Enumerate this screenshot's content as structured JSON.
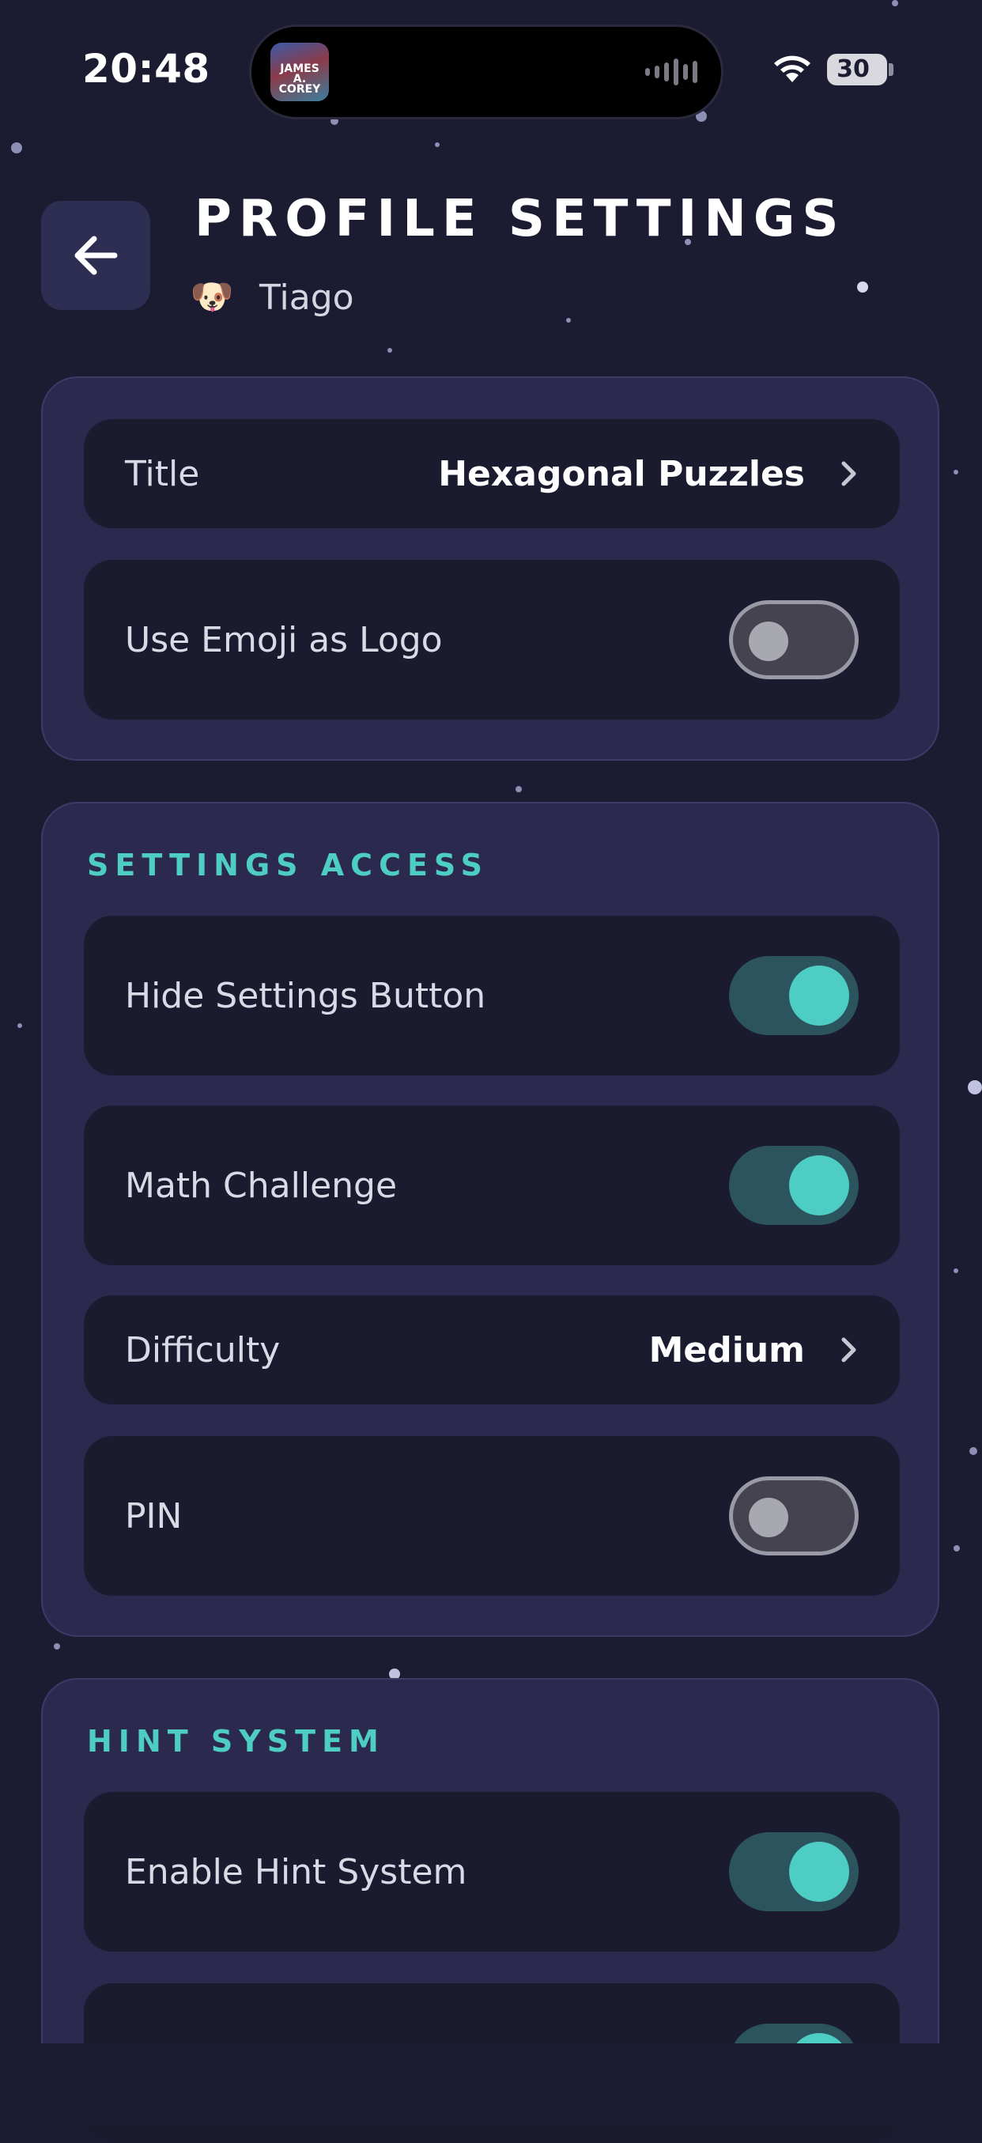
{
  "status_bar": {
    "time": "20:48",
    "now_playing_art_text": "JAMES A. COREY",
    "battery": "30"
  },
  "header": {
    "title": "PROFILE SETTINGS",
    "profile_emoji": "🐶",
    "profile_name": "Tiago",
    "back_icon": "arrow-left-icon"
  },
  "general": {
    "title_label": "Title",
    "title_value": "Hexagonal Puzzles",
    "emoji_logo_label": "Use Emoji as Logo",
    "emoji_logo_on": false
  },
  "settings_access": {
    "section_title": "SETTINGS ACCESS",
    "hide_settings_label": "Hide Settings Button",
    "hide_settings_on": true,
    "math_challenge_label": "Math Challenge",
    "math_challenge_on": true,
    "difficulty_label": "Difficulty",
    "difficulty_value": "Medium",
    "pin_label": "PIN",
    "pin_on": false
  },
  "hint_system": {
    "section_title": "HINT SYSTEM",
    "enable_hints_label": "Enable Hint System",
    "enable_hints_on": true,
    "next_row_on": true
  },
  "colors": {
    "background": "#1b1b31",
    "card": "#2b2a4e",
    "row": "#1b1b30",
    "accent": "#4ecdc4",
    "toggle_on_track": "#2b545e",
    "toggle_off_track": "#44434f"
  }
}
